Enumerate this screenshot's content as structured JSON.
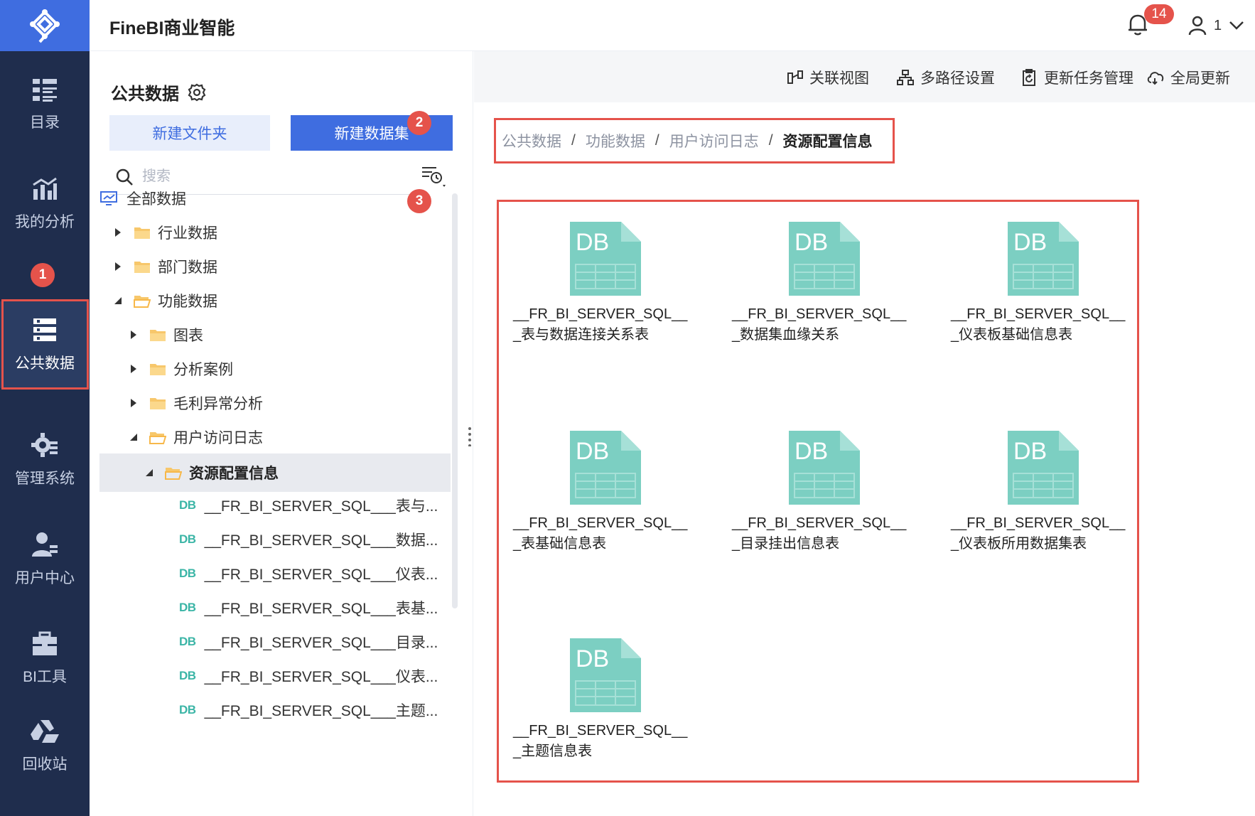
{
  "app": {
    "title": "FineBI商业智能"
  },
  "header": {
    "notification_count": "14",
    "user_name": "1"
  },
  "nav": {
    "items": [
      {
        "label": "目录",
        "icon": "catalog-icon"
      },
      {
        "label": "我的分析",
        "icon": "analysis-icon"
      },
      {
        "label": "公共数据",
        "icon": "public-data-icon"
      },
      {
        "label": "管理系统",
        "icon": "manage-system-icon"
      },
      {
        "label": "用户中心",
        "icon": "user-center-icon"
      },
      {
        "label": "BI工具",
        "icon": "bi-tool-icon"
      },
      {
        "label": "回收站",
        "icon": "recycle-icon"
      }
    ]
  },
  "markers": {
    "m1": "1",
    "m2": "2",
    "m3": "3"
  },
  "panel": {
    "title": "公共数据",
    "new_folder": "新建文件夹",
    "new_dataset": "新建数据集",
    "search_placeholder": "搜索",
    "tree": [
      {
        "label": "全部数据"
      },
      {
        "label": "行业数据"
      },
      {
        "label": "部门数据"
      },
      {
        "label": "功能数据"
      },
      {
        "label": "图表"
      },
      {
        "label": "分析案例"
      },
      {
        "label": "毛利异常分析"
      },
      {
        "label": "用户访问日志"
      },
      {
        "label": "资源配置信息"
      }
    ],
    "db_tag": "DB",
    "tables": [
      "__FR_BI_SERVER_SQL___表与...",
      "__FR_BI_SERVER_SQL___数据...",
      "__FR_BI_SERVER_SQL___仪表...",
      "__FR_BI_SERVER_SQL___表基...",
      "__FR_BI_SERVER_SQL___目录...",
      "__FR_BI_SERVER_SQL___仪表...",
      "__FR_BI_SERVER_SQL___主题..."
    ]
  },
  "toolbar": {
    "relation_view": "关联视图",
    "multi_path": "多路径设置",
    "update_task": "更新任务管理",
    "global_update": "全局更新"
  },
  "breadcrumb": {
    "items": [
      "公共数据",
      "功能数据",
      "用户访问日志",
      "资源配置信息"
    ],
    "separator": "/"
  },
  "cards": [
    {
      "line1": "__FR_BI_SERVER_SQL__",
      "line2": "_表与数据连接关系表"
    },
    {
      "line1": "__FR_BI_SERVER_SQL__",
      "line2": "_数据集血缘关系"
    },
    {
      "line1": "__FR_BI_SERVER_SQL__",
      "line2": "_仪表板基础信息表"
    },
    {
      "line1": "__FR_BI_SERVER_SQL__",
      "line2": "_表基础信息表"
    },
    {
      "line1": "__FR_BI_SERVER_SQL__",
      "line2": "_目录挂出信息表"
    },
    {
      "line1": "__FR_BI_SERVER_SQL__",
      "line2": "_仪表板所用数据集表"
    },
    {
      "line1": "__FR_BI_SERVER_SQL__",
      "line2": "_主题信息表"
    }
  ],
  "colors": {
    "accent": "#3f6de0",
    "nav_bg": "#1f2d4d",
    "highlight": "#e5534b",
    "db_file": "#7ccfc2"
  }
}
